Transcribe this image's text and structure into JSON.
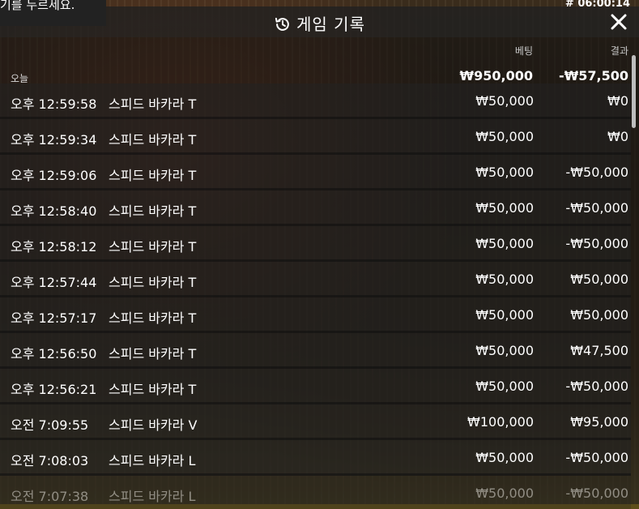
{
  "hint": {
    "text": "기를 누르세요."
  },
  "round_id": "# 06:00:14",
  "header": {
    "title": "게임 기록"
  },
  "columns": {
    "bet": "베팅",
    "result": "결과"
  },
  "today": {
    "label": "오늘",
    "bet_total": "₩950,000",
    "result_total": "-₩57,500"
  },
  "rows": [
    {
      "time": "오후 12:59:58",
      "game": "스피드 바카라 T",
      "bet": "₩50,000",
      "result": "₩0"
    },
    {
      "time": "오후 12:59:34",
      "game": "스피드 바카라 T",
      "bet": "₩50,000",
      "result": "₩0"
    },
    {
      "time": "오후 12:59:06",
      "game": "스피드 바카라 T",
      "bet": "₩50,000",
      "result": "-₩50,000"
    },
    {
      "time": "오후 12:58:40",
      "game": "스피드 바카라 T",
      "bet": "₩50,000",
      "result": "-₩50,000"
    },
    {
      "time": "오후 12:58:12",
      "game": "스피드 바카라 T",
      "bet": "₩50,000",
      "result": "-₩50,000"
    },
    {
      "time": "오후 12:57:44",
      "game": "스피드 바카라 T",
      "bet": "₩50,000",
      "result": "₩50,000"
    },
    {
      "time": "오후 12:57:17",
      "game": "스피드 바카라 T",
      "bet": "₩50,000",
      "result": "₩50,000"
    },
    {
      "time": "오후 12:56:50",
      "game": "스피드 바카라 T",
      "bet": "₩50,000",
      "result": "₩47,500"
    },
    {
      "time": "오후 12:56:21",
      "game": "스피드 바카라 T",
      "bet": "₩50,000",
      "result": "-₩50,000"
    },
    {
      "time": "오전 7:09:55",
      "game": "스피드 바카라 V",
      "bet": "₩100,000",
      "result": "₩95,000"
    },
    {
      "time": "오전 7:08:03",
      "game": "스피드 바카라 L",
      "bet": "₩50,000",
      "result": "-₩50,000"
    },
    {
      "time": "오전 7:07:38",
      "game": "스피드 바카라 L",
      "bet": "₩50,000",
      "result": "-₩50,000"
    }
  ],
  "icons": {
    "history": "history-icon",
    "close": "close-icon"
  }
}
